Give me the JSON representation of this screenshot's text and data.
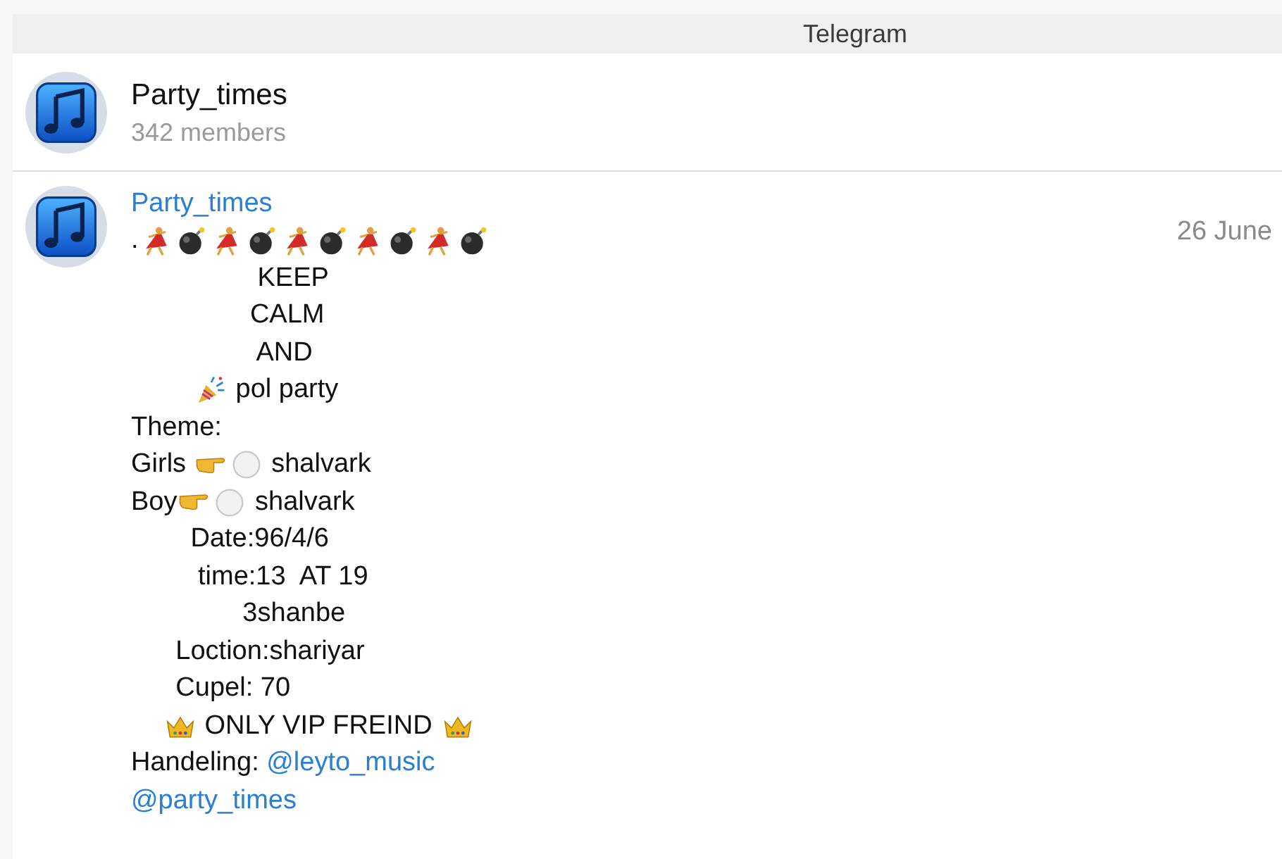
{
  "window": {
    "title": "Telegram"
  },
  "chat_header": {
    "name": "Party_times",
    "subtitle": "342 members"
  },
  "messages": [
    {
      "sender": "Party_times",
      "date": "26 June",
      "lines": [
        {
          "segments": [
            {
              "kind": "text",
              "text": "."
            },
            {
              "kind": "dancer"
            },
            {
              "kind": "bomb"
            },
            {
              "kind": "dancer"
            },
            {
              "kind": "bomb"
            },
            {
              "kind": "dancer"
            },
            {
              "kind": "bomb"
            },
            {
              "kind": "dancer"
            },
            {
              "kind": "bomb"
            },
            {
              "kind": "dancer"
            },
            {
              "kind": "bomb"
            }
          ]
        },
        {
          "segments": [
            {
              "kind": "text",
              "text": "                 KEEP"
            }
          ]
        },
        {
          "segments": [
            {
              "kind": "text",
              "text": "                CALM"
            }
          ]
        },
        {
          "segments": [
            {
              "kind": "text",
              "text": "                 AND"
            }
          ]
        },
        {
          "segments": [
            {
              "kind": "indent"
            },
            {
              "kind": "indent"
            },
            {
              "kind": "popper"
            },
            {
              "kind": "text",
              "text": " pol party"
            }
          ]
        },
        {
          "segments": [
            {
              "kind": "text",
              "text": "Theme:"
            }
          ]
        },
        {
          "segments": [
            {
              "kind": "text",
              "text": "Girls "
            },
            {
              "kind": "finger"
            },
            {
              "kind": "circle"
            },
            {
              "kind": "text",
              "text": " shalvark"
            }
          ]
        },
        {
          "segments": [
            {
              "kind": "text",
              "text": "Boy"
            },
            {
              "kind": "finger"
            },
            {
              "kind": "circle"
            },
            {
              "kind": "text",
              "text": " shalvark"
            }
          ]
        },
        {
          "segments": [
            {
              "kind": "text",
              "text": "        Date:96/4/6"
            }
          ]
        },
        {
          "segments": [
            {
              "kind": "text",
              "text": "         time:13  AT 19"
            }
          ]
        },
        {
          "segments": [
            {
              "kind": "text",
              "text": "               3shanbe"
            }
          ]
        },
        {
          "segments": [
            {
              "kind": "text",
              "text": "      Loction:shariyar"
            }
          ]
        },
        {
          "segments": [
            {
              "kind": "text",
              "text": "      Cupel: 70"
            }
          ]
        },
        {
          "segments": [
            {
              "kind": "indent"
            },
            {
              "kind": "crown"
            },
            {
              "kind": "text",
              "text": " ONLY VIP FREIND "
            },
            {
              "kind": "crown"
            }
          ]
        },
        {
          "segments": [
            {
              "kind": "text",
              "text": "Handeling: "
            },
            {
              "kind": "link",
              "text": "@leyto_music"
            }
          ]
        },
        {
          "segments": [
            {
              "kind": "link",
              "text": "@party_times"
            }
          ]
        }
      ]
    }
  ]
}
